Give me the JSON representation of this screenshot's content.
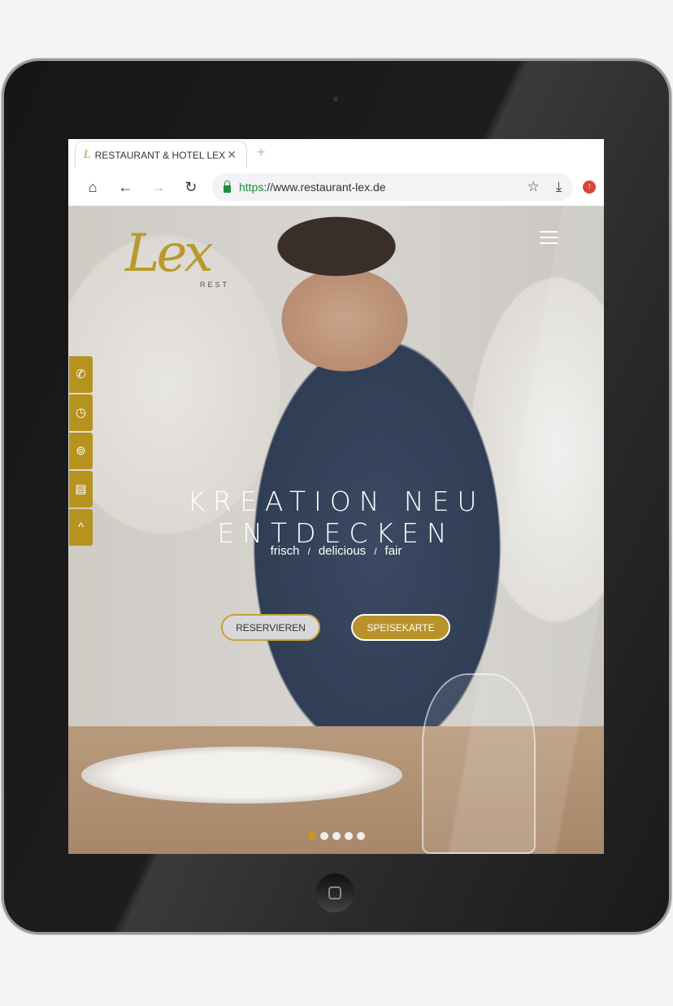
{
  "browser": {
    "tab_title": "RESTAURANT & HOTEL LEX",
    "url_scheme": "https",
    "url_rest": "://www.restaurant-lex.de"
  },
  "site": {
    "logo": "Lex",
    "logo_sub": "REST",
    "side_icons": [
      "phone-icon",
      "clock-icon",
      "dining-icon",
      "document-icon",
      "chevron-up-icon"
    ],
    "headline": "KREATION NEU ENTDECKEN",
    "tagline": [
      "frisch",
      "delicious",
      "fair"
    ],
    "tagline_sep": "/",
    "buttons": {
      "reserve": "RESERVIEREN",
      "menu": "SPEISEKARTE"
    },
    "slides": {
      "count": 5,
      "active": 1
    }
  },
  "colors": {
    "accent": "#b6921e",
    "secure": "#1e8e3e"
  }
}
